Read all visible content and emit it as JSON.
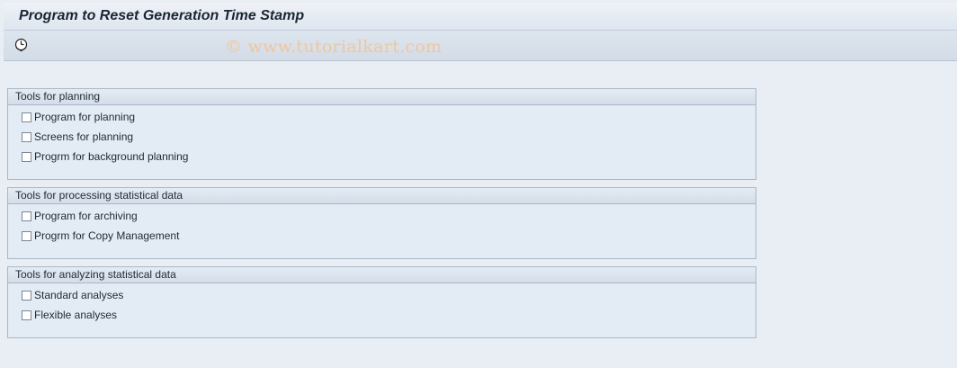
{
  "title": "Program to Reset Generation Time Stamp",
  "toolbar": {
    "execute_icon": "execute-clock-icon",
    "watermark": "© www.tutorialkart.com"
  },
  "groups": [
    {
      "header": "Tools for planning",
      "items": [
        {
          "label": "Program for planning",
          "checked": false
        },
        {
          "label": "Screens for planning",
          "checked": false
        },
        {
          "label": "Progrm for background planning",
          "checked": false
        }
      ]
    },
    {
      "header": "Tools for processing statistical data",
      "items": [
        {
          "label": "Program for archiving",
          "checked": false
        },
        {
          "label": "Progrm for Copy Management",
          "checked": false
        }
      ]
    },
    {
      "header": "Tools for analyzing statistical data",
      "items": [
        {
          "label": "Standard analyses",
          "checked": false
        },
        {
          "label": "Flexible analyses",
          "checked": false
        }
      ]
    }
  ]
}
